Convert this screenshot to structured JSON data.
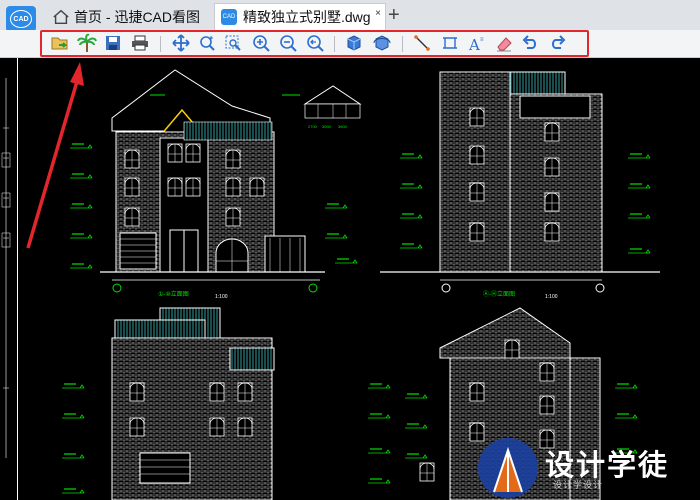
{
  "app": {
    "logo_text": "CAD",
    "accent": "#2b8be6"
  },
  "tabs": [
    {
      "label": "首页 - 迅捷CAD看图",
      "icon": "home-icon",
      "active": false
    },
    {
      "label": "精致独立式别墅.dwg",
      "icon": "cad-file-icon",
      "active": true,
      "close": "×"
    }
  ],
  "tab_add": "+",
  "toolbar": {
    "highlight_color": "#e3262b",
    "buttons": [
      "open-file-icon",
      "palm-tree-icon",
      "save-icon",
      "print-icon",
      "pan-icon",
      "zoom-realtime-icon",
      "zoom-window-icon",
      "zoom-in-icon",
      "zoom-out-icon",
      "zoom-previous-icon",
      "3d-view-icon",
      "3d-orbit-icon",
      "measure-distance-icon",
      "measure-area-icon",
      "text-icon",
      "eraser-icon",
      "undo-icon",
      "redo-icon"
    ]
  },
  "drawing": {
    "elevation_labels": [
      "①-⑩立面图",
      "Ⓐ-Ⓗ立面图"
    ],
    "scales": [
      "1:100",
      "1:100"
    ],
    "dimensions": [
      "2700",
      "3000",
      "3600"
    ]
  },
  "watermark": {
    "title": "设计学徒",
    "subtitle": "设计学设计"
  }
}
